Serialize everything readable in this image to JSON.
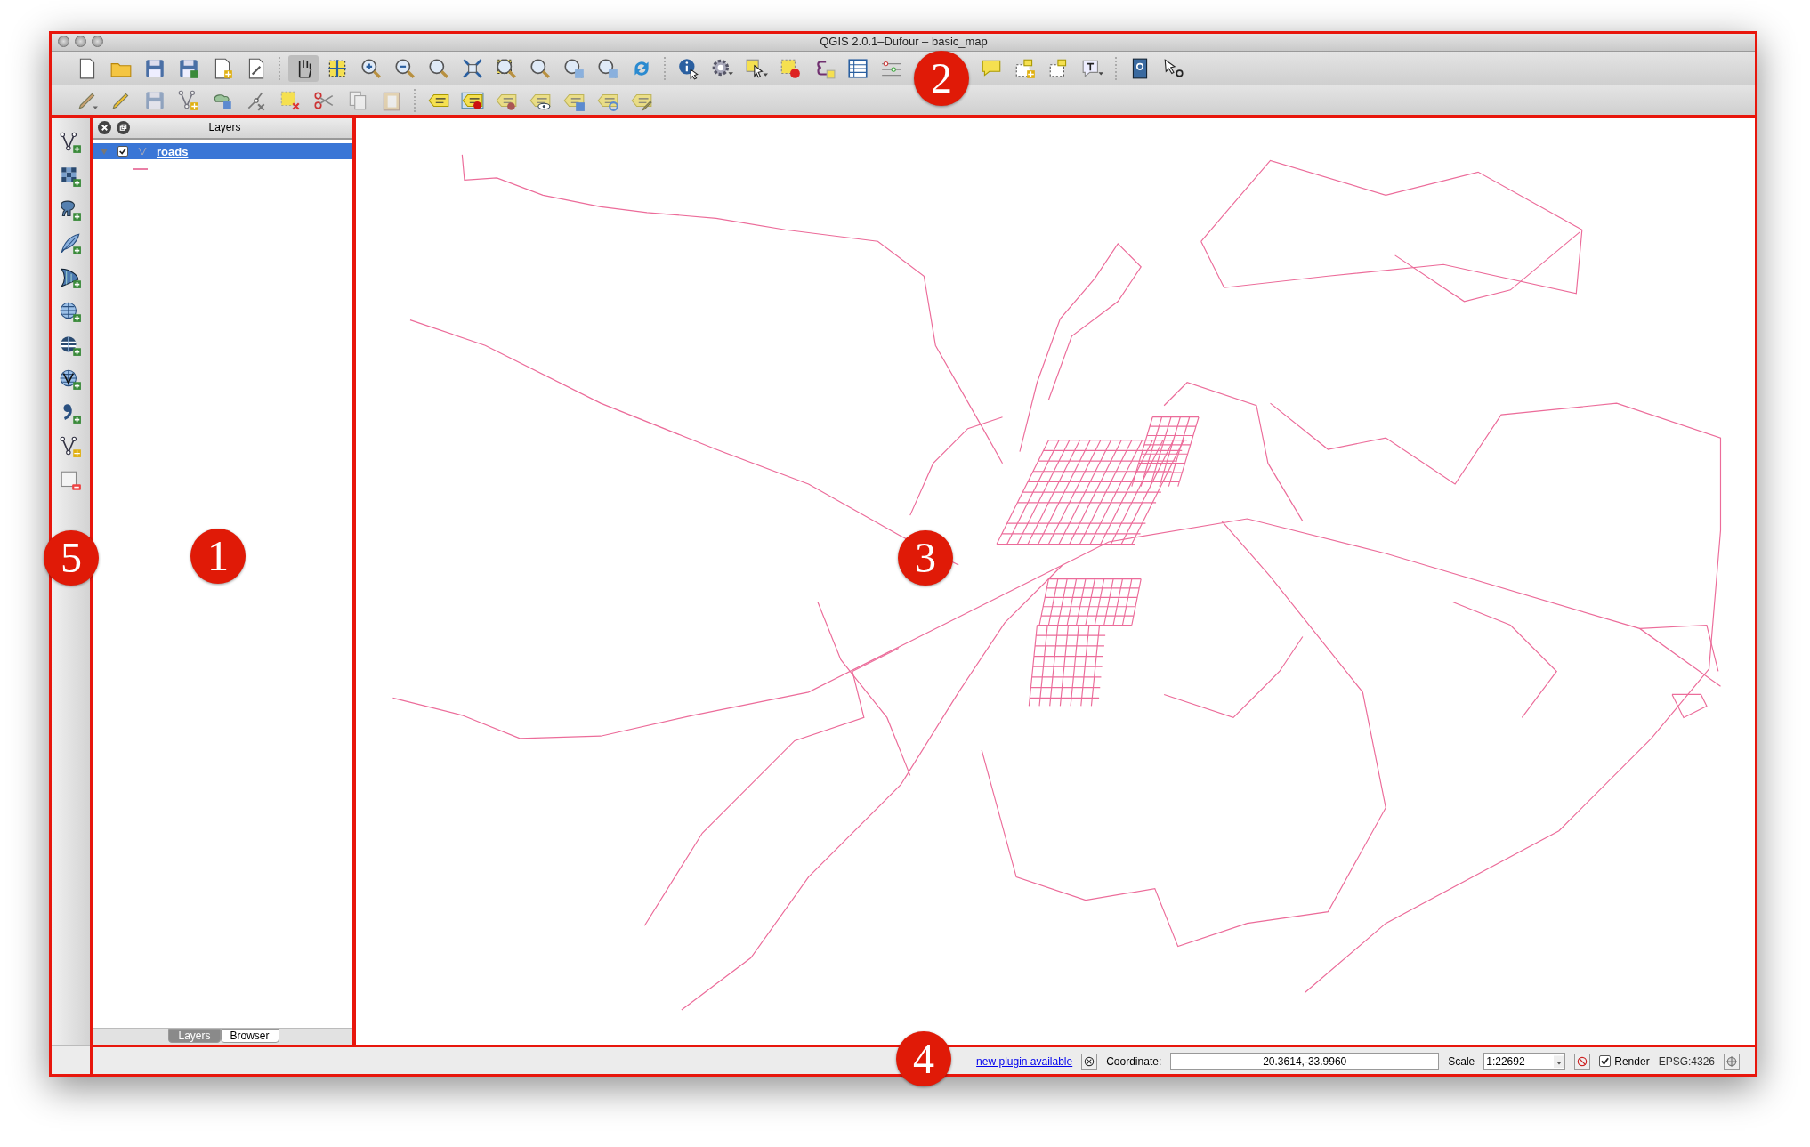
{
  "window": {
    "title": "QGIS 2.0.1–Dufour – basic_map"
  },
  "layers_panel": {
    "title": "Layers",
    "layers": [
      {
        "name": "roads",
        "checked": true,
        "selected": true,
        "expanded": true
      }
    ]
  },
  "panel_tabs": [
    {
      "label": "Layers",
      "selected": true
    },
    {
      "label": "Browser",
      "selected": false
    }
  ],
  "status_bar": {
    "message": "new plugin available",
    "coordinate_label": "Coordinate:",
    "coordinate": "20.3614,-33.9960",
    "scale_label": "Scale",
    "scale": "1:22692",
    "render": {
      "label": "Render",
      "checked": true
    },
    "crs": "EPSG:4326"
  },
  "callouts": [
    {
      "number": "2"
    },
    {
      "number": "5"
    },
    {
      "number": "1"
    },
    {
      "number": "3"
    },
    {
      "number": "4"
    }
  ]
}
